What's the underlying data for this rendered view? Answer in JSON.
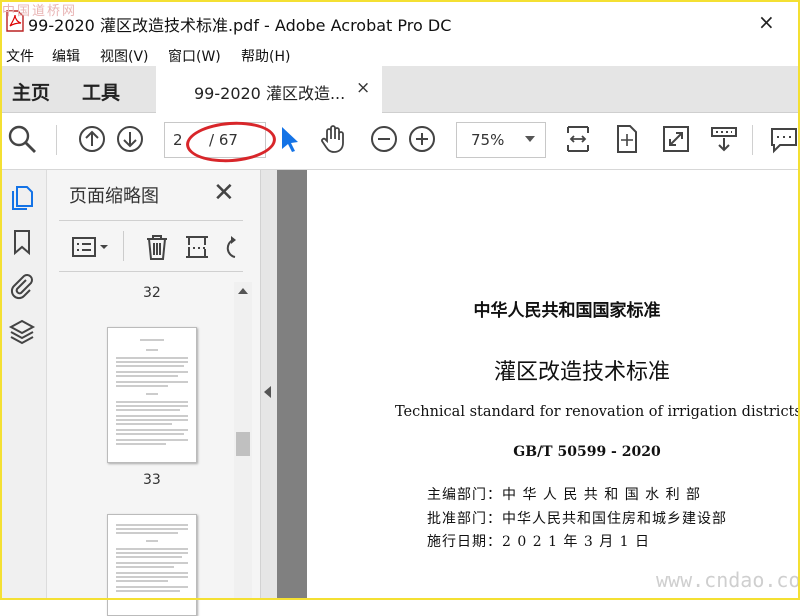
{
  "watermark_top": "中国道桥网",
  "window": {
    "title": "99-2020 灌区改造技术标准.pdf - Adobe Acrobat Pro DC",
    "close": "×"
  },
  "menu": [
    "文件",
    "编辑",
    "视图(V)",
    "窗口(W)",
    "帮助(H)"
  ],
  "tabs": {
    "home": "主页",
    "tools": "工具",
    "doc": "99-2020 灌区改造...",
    "doc_close": "×"
  },
  "toolbar": {
    "page_current": "2",
    "page_total": "/ 67",
    "zoom": "75%"
  },
  "panel": {
    "title": "页面缩略图",
    "close": "✕",
    "thumbs": [
      {
        "label": "32"
      },
      {
        "label": "33"
      }
    ]
  },
  "document": {
    "header": "中华人民共和国国家标准",
    "title": "灌区改造技术标准",
    "title_en": "Technical standard for renovation of irrigation districts",
    "code": "GB/T 50599 - 2020",
    "lines": [
      "主编部门：中 华 人 民 共 和 国 水 利 部",
      "批准部门：中华人民共和国住房和城乡建设部",
      "施行日期：2 0 2 1 年 3 月 1 日"
    ]
  },
  "watermark_bottom": "www.cndao.com",
  "colors": {
    "accent": "#1473e6",
    "highlight": "#d8262a",
    "frame": "#f4e033"
  }
}
